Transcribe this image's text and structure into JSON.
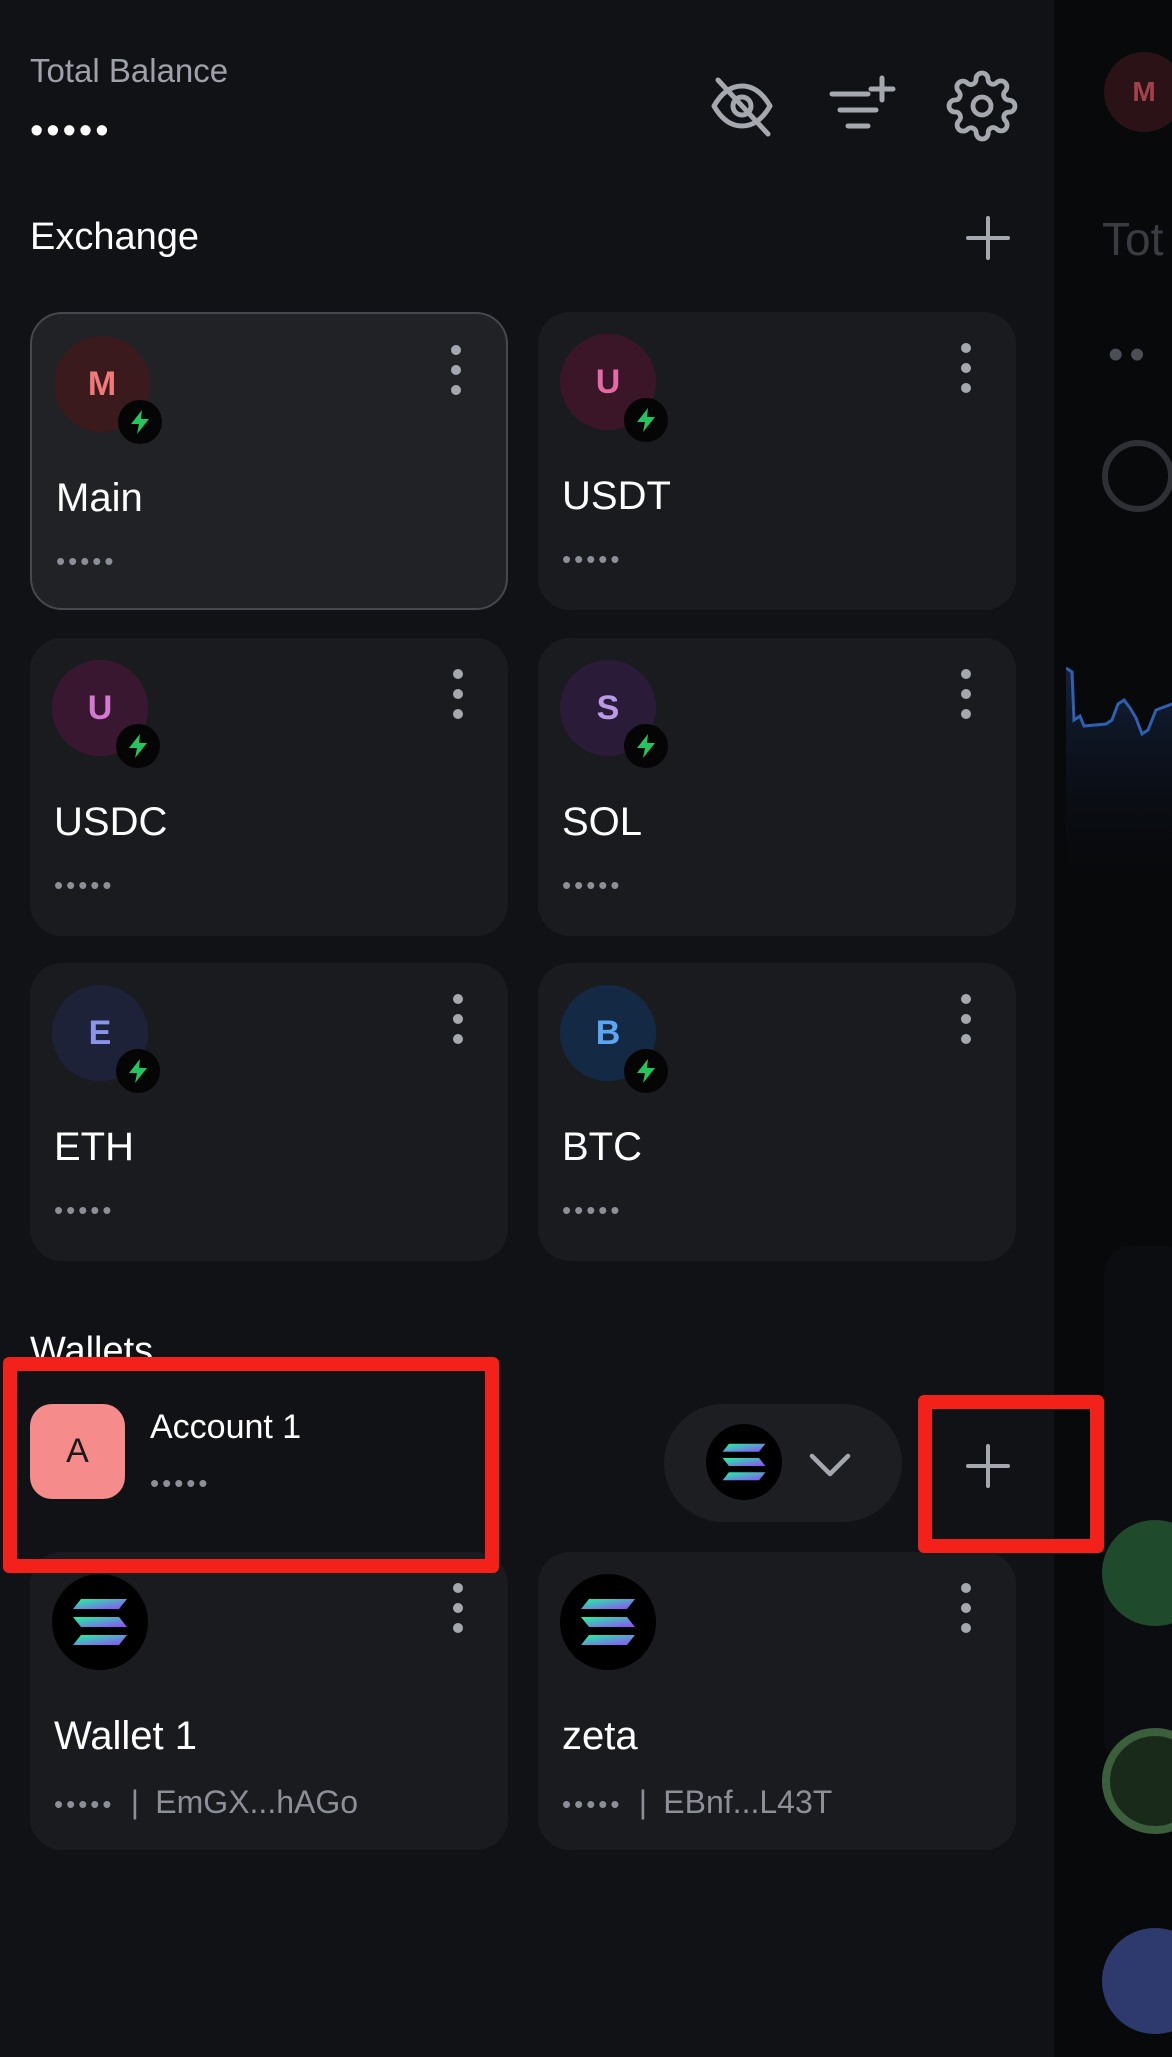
{
  "header": {
    "total_balance_label": "Total Balance",
    "total_balance_value": "•••••",
    "icons": [
      "eye-off-icon",
      "filter-add-icon",
      "gear-icon"
    ]
  },
  "exchange": {
    "title": "Exchange",
    "add_icon": "plus-icon",
    "accounts": [
      {
        "initial": "M",
        "name": "Main",
        "balance": "•••••",
        "avatar_bg": "#3a1a1d",
        "avatar_fg": "#f07a7a",
        "selected": true
      },
      {
        "initial": "U",
        "name": "USDT",
        "balance": "•••••",
        "avatar_bg": "#3a1628",
        "avatar_fg": "#e46aa6",
        "selected": false
      },
      {
        "initial": "U",
        "name": "USDC",
        "balance": "•••••",
        "avatar_bg": "#3a1730",
        "avatar_fg": "#d27ad0",
        "selected": false
      },
      {
        "initial": "S",
        "name": "SOL",
        "balance": "•••••",
        "avatar_bg": "#2a1c38",
        "avatar_fg": "#b99ae6",
        "selected": false
      },
      {
        "initial": "E",
        "name": "ETH",
        "balance": "•••••",
        "avatar_bg": "#1e2238",
        "avatar_fg": "#8a94e8",
        "selected": false
      },
      {
        "initial": "B",
        "name": "BTC",
        "balance": "•••••",
        "avatar_bg": "#142a44",
        "avatar_fg": "#5aa6f0",
        "selected": false
      }
    ]
  },
  "wallets": {
    "title": "Wallets",
    "account": {
      "initial": "A",
      "name": "Account 1",
      "balance": "•••••",
      "color": "#f58b8b"
    },
    "chain_icon": "solana-icon",
    "items": [
      {
        "name": "Wallet 1",
        "balance": "•••••",
        "address": "EmGX...hAGo"
      },
      {
        "name": "zeta",
        "balance": "•••••",
        "address": "EBnf...L43T"
      }
    ]
  },
  "background_page": {
    "avatar_initial": "M",
    "title_fragment": "Tot",
    "dots": "••"
  },
  "colors": {
    "accent_green": "#22c55e",
    "highlight_red": "#f4211b"
  }
}
